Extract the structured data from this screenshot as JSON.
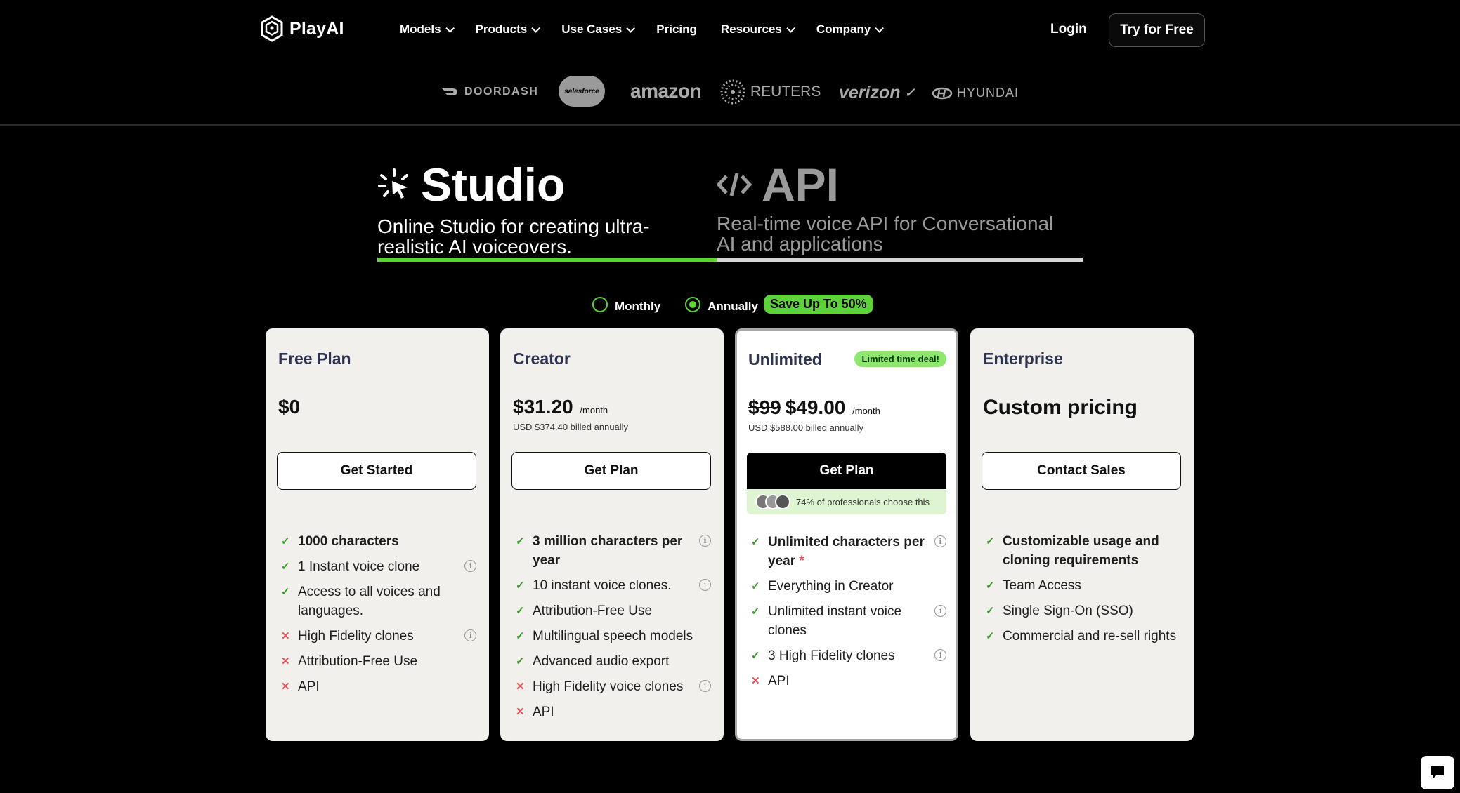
{
  "nav": {
    "brand": "PlayAI",
    "menu": [
      {
        "label": "Models",
        "dropdown": true
      },
      {
        "label": "Products",
        "dropdown": true
      },
      {
        "label": "Use Cases",
        "dropdown": true
      },
      {
        "label": "Pricing",
        "dropdown": false
      },
      {
        "label": "Resources",
        "dropdown": true
      },
      {
        "label": "Company",
        "dropdown": true
      }
    ],
    "login": "Login",
    "try_free": "Try for Free"
  },
  "logos": [
    "DOORDASH",
    "salesforce",
    "amazon",
    "REUTERS",
    "verizon",
    "HYUNDAI"
  ],
  "tabs": {
    "studio": {
      "title": "Studio",
      "desc": "Online Studio for creating ultra-realistic AI voiceovers."
    },
    "api": {
      "title": "API",
      "desc": "Real-time voice API for Conversational AI and applications"
    }
  },
  "billing": {
    "monthly": "Monthly",
    "annually": "Annually",
    "save": "Save Up To 50%",
    "selected": "annually"
  },
  "plans": {
    "free": {
      "name": "Free Plan",
      "price": "$0",
      "cta": "Get Started",
      "features": [
        {
          "text": "1000 characters",
          "ok": true,
          "bold": true,
          "info": false
        },
        {
          "text": "1 Instant voice clone",
          "ok": true,
          "info": true
        },
        {
          "text": "Access to all voices and languages.",
          "ok": true,
          "info": false
        },
        {
          "text": "High Fidelity clones",
          "ok": false,
          "info": true
        },
        {
          "text": "Attribution-Free Use",
          "ok": false,
          "info": false
        },
        {
          "text": "API",
          "ok": false,
          "info": false
        }
      ]
    },
    "creator": {
      "name": "Creator",
      "price": "$31.20",
      "per": "/month",
      "billed": "USD $374.40 billed annually",
      "cta": "Get Plan",
      "features": [
        {
          "text": "3 million characters per year",
          "ok": true,
          "bold": true,
          "info": true
        },
        {
          "text": "10 instant voice clones.",
          "ok": true,
          "info": true
        },
        {
          "text": "Attribution-Free Use",
          "ok": true,
          "info": false
        },
        {
          "text": "Multilingual speech models",
          "ok": true,
          "info": false
        },
        {
          "text": "Advanced audio export",
          "ok": true,
          "info": false
        },
        {
          "text": "High Fidelity voice clones",
          "ok": false,
          "info": true
        },
        {
          "text": "API",
          "ok": false,
          "info": false
        }
      ]
    },
    "unlimited": {
      "name": "Unlimited",
      "badge": "Limited time deal!",
      "old_price": "$99",
      "price": "$49.00",
      "per": "/month",
      "billed": "USD $588.00 billed annually",
      "cta": "Get Plan",
      "social_proof": "74% of professionals choose this",
      "features": [
        {
          "text": "Unlimited characters per year",
          "star": "*",
          "ok": true,
          "bold": true,
          "info": true
        },
        {
          "text": "Everything in Creator",
          "ok": true,
          "info": false
        },
        {
          "text": "Unlimited instant voice clones",
          "ok": true,
          "info": true
        },
        {
          "text": "3 High Fidelity clones",
          "ok": true,
          "info": true
        },
        {
          "text": "API",
          "ok": false,
          "info": false
        }
      ]
    },
    "enterprise": {
      "name": "Enterprise",
      "price": "Custom pricing",
      "cta": "Contact Sales",
      "features": [
        {
          "text": "Customizable usage and cloning requirements",
          "ok": true,
          "bold": true,
          "info": false
        },
        {
          "text": "Team Access",
          "ok": true,
          "info": false
        },
        {
          "text": "Single Sign-On (SSO)",
          "ok": true,
          "info": false
        },
        {
          "text": "Commercial and re-sell rights",
          "ok": true,
          "info": false
        }
      ]
    }
  },
  "colors": {
    "accent": "#5dd23a",
    "check": "#3a9b2a",
    "cross": "#e2555a",
    "badge": "#8ee870"
  }
}
